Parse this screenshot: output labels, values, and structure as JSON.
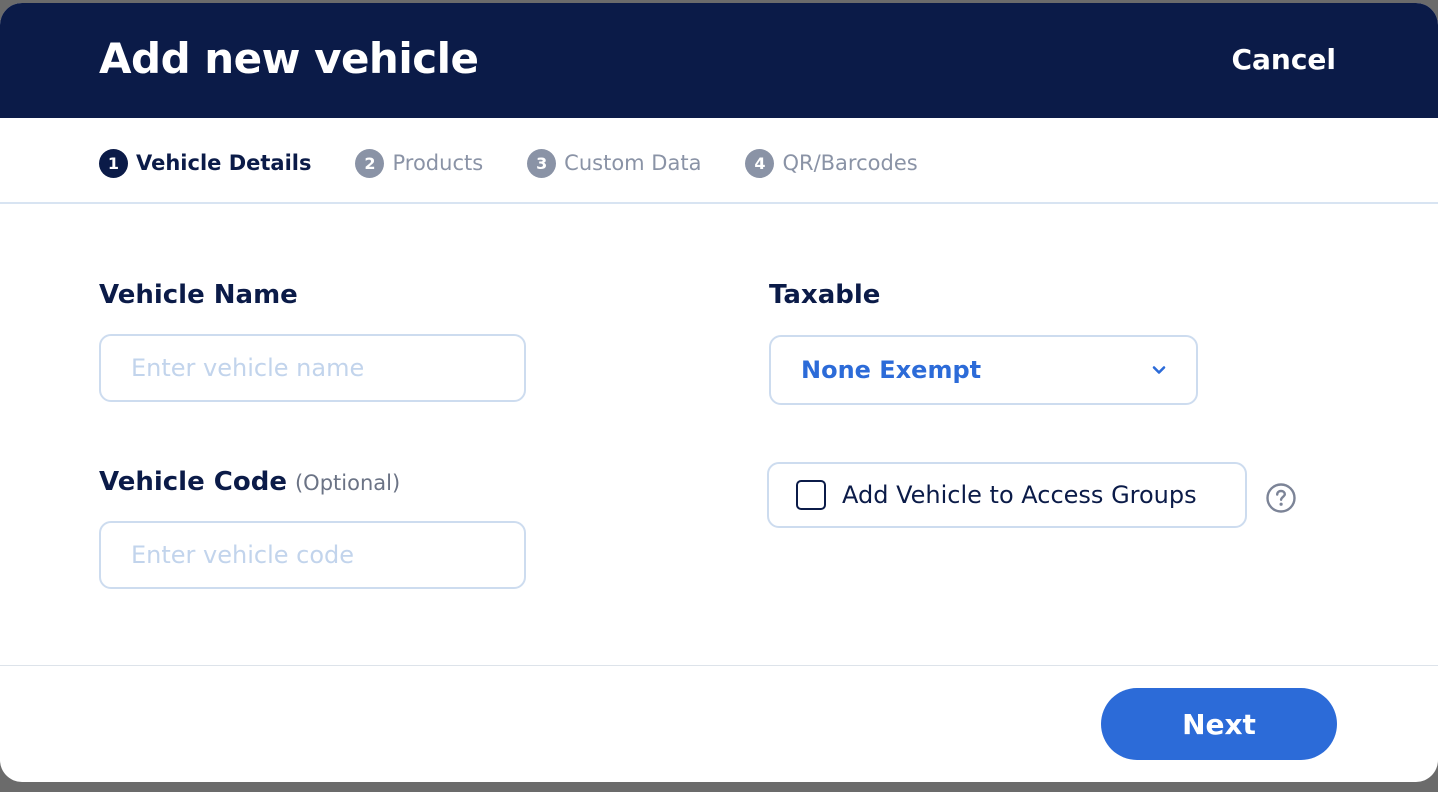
{
  "header": {
    "title": "Add new vehicle",
    "cancel_label": "Cancel"
  },
  "steps": [
    {
      "number": "1",
      "label": "Vehicle Details",
      "active": true
    },
    {
      "number": "2",
      "label": "Products",
      "active": false
    },
    {
      "number": "3",
      "label": "Custom Data",
      "active": false
    },
    {
      "number": "4",
      "label": "QR/Barcodes",
      "active": false
    }
  ],
  "form": {
    "vehicle_name": {
      "label": "Vehicle Name",
      "placeholder": "Enter vehicle name",
      "value": ""
    },
    "vehicle_code": {
      "label": "Vehicle Code",
      "optional_label": "(Optional)",
      "placeholder": "Enter vehicle code",
      "value": ""
    },
    "taxable": {
      "label": "Taxable",
      "selected": "None Exempt"
    },
    "access_groups": {
      "label": "Add Vehicle to Access Groups",
      "checked": false
    }
  },
  "footer": {
    "next_label": "Next"
  },
  "colors": {
    "header_bg": "#0b1b48",
    "accent": "#2c6bd8",
    "muted": "#8a93a6",
    "border": "#cddcef"
  },
  "icons": {
    "dropdown": "chevron-down-icon",
    "help": "question-circle-icon"
  }
}
